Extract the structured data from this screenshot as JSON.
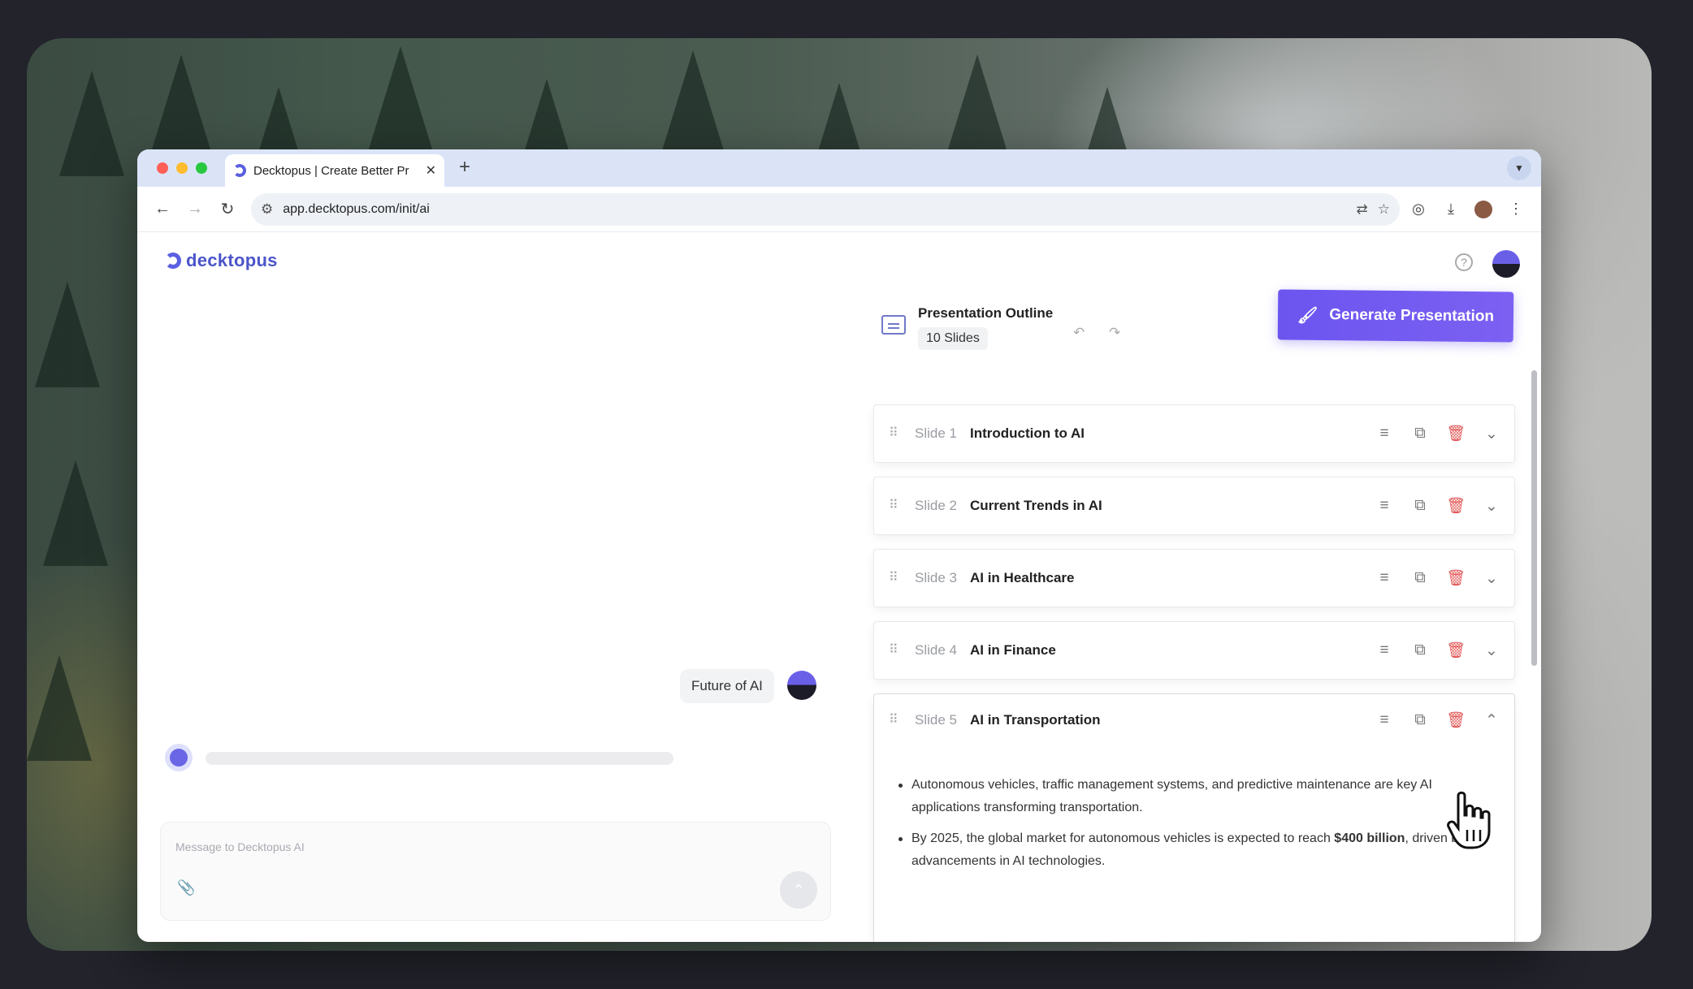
{
  "browser": {
    "tab_title": "Decktopus | Create Better Pr",
    "tab_close": "✕",
    "new_tab": "+",
    "url": "app.decktopus.com/init/ai"
  },
  "app": {
    "logo_text": "decktopus",
    "help_glyph": "?"
  },
  "chat": {
    "user_message": "Future of AI",
    "composer_placeholder": "Message to Decktopus AI"
  },
  "outline": {
    "title": "Presentation Outline",
    "slide_count": "10 Slides",
    "generate_label": "Generate Presentation",
    "slides": [
      {
        "number": "Slide 1",
        "title": "Introduction to AI"
      },
      {
        "number": "Slide 2",
        "title": "Current Trends in AI"
      },
      {
        "number": "Slide 3",
        "title": "AI in Healthcare"
      },
      {
        "number": "Slide 4",
        "title": "AI in Finance"
      },
      {
        "number": "Slide 5",
        "title": "AI in Transportation"
      }
    ],
    "expanded_bullets": {
      "b1": "Autonomous vehicles, traffic management systems, and predictive maintenance are key AI applications transforming transportation.",
      "b2_pre": "By 2025, the global market for autonomous vehicles is expected to reach ",
      "b2_bold": "$400 billion",
      "b2_post": ", driven by advancements in AI technologies."
    }
  },
  "colors": {
    "accent": "#6b55ef",
    "brand": "#4b55c9",
    "delete": "#e25454"
  },
  "icons": [
    "back-arrow-icon",
    "forward-arrow-icon",
    "reload-icon",
    "site-settings-icon",
    "translate-icon",
    "star-icon",
    "extension-icon",
    "download-icon",
    "profile-icon",
    "kebab-menu-icon",
    "help-icon",
    "folder-outline-icon",
    "undo-icon",
    "redo-icon",
    "brush-icon",
    "drag-handle-icon",
    "edit-notes-icon",
    "copy-icon",
    "trash-icon",
    "chevron-down-icon",
    "chevron-up-icon",
    "attach-icon",
    "send-icon",
    "hand-cursor-icon"
  ]
}
